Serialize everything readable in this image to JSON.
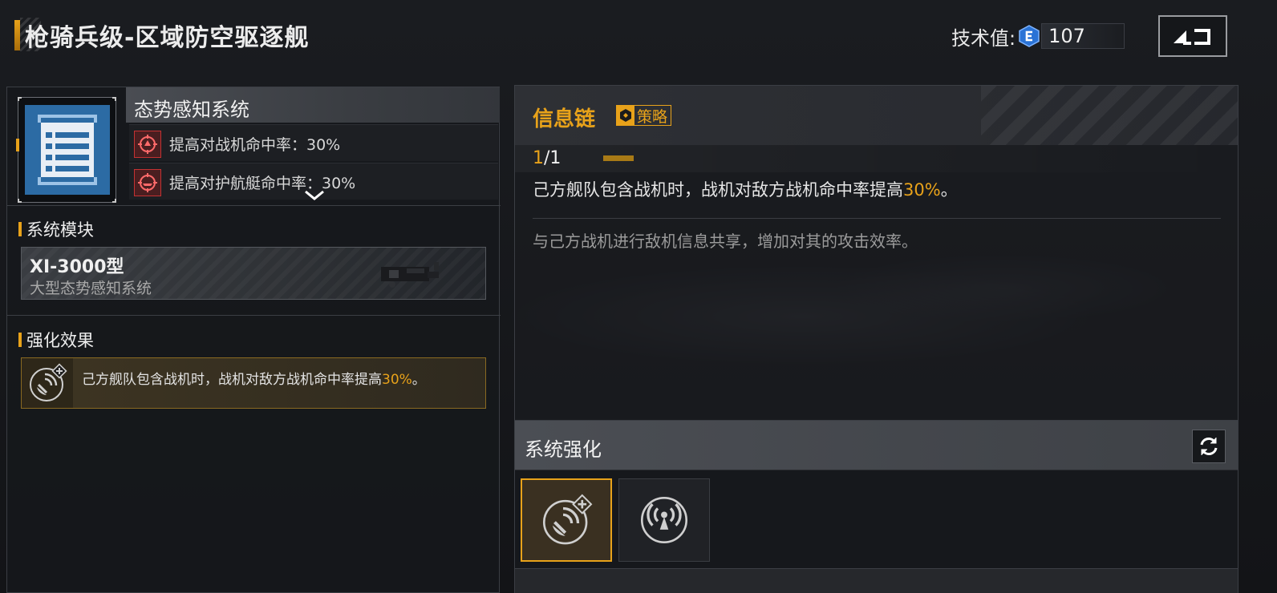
{
  "header": {
    "title": "枪骑兵级-区域防空驱逐舰",
    "tech_label": "技术值:",
    "tech_value": "107",
    "tech_icon": "tech-point-icon",
    "back_icon": "back-arrow-icon"
  },
  "system": {
    "name": "态势感知系统",
    "icon": "list-icon",
    "effects": [
      {
        "icon": "crosshair-plane-icon",
        "text": "提高对战机命中率：30%"
      },
      {
        "icon": "crosshair-ship-icon",
        "text": "提高对护航艇命中率：30%"
      }
    ],
    "expand_icon": "chevron-down-icon"
  },
  "module": {
    "heading": "系统模块",
    "name": "XI-3000型",
    "subtitle": "大型态势感知系统"
  },
  "enhancement": {
    "heading": "强化效果",
    "text_prefix": "己方舰队包含战机时，战机对敌方战机命中率提高",
    "text_value": "30%",
    "text_suffix": "。"
  },
  "detail": {
    "skill_name": "信息链",
    "tag_label": "策略",
    "level_current": "1",
    "level_sep": "/",
    "level_max": "1",
    "desc_prefix": "己方舰队包含战机时，战机对敌方战机命中率提高",
    "desc_value": "30%",
    "desc_suffix": "。",
    "flavor": "与己方战机进行敌机信息共享，增加对其的攻击效率。"
  },
  "system_enhance": {
    "title": "系统强化",
    "refresh_icon": "refresh-icon",
    "slots": [
      {
        "icon": "satellite-dish-icon",
        "selected": true
      },
      {
        "icon": "radio-tower-icon",
        "selected": false
      }
    ]
  },
  "colors": {
    "accent": "#e8a21a",
    "system_icon_bg": "#2c6ba4",
    "effect_red": "#c43232"
  }
}
